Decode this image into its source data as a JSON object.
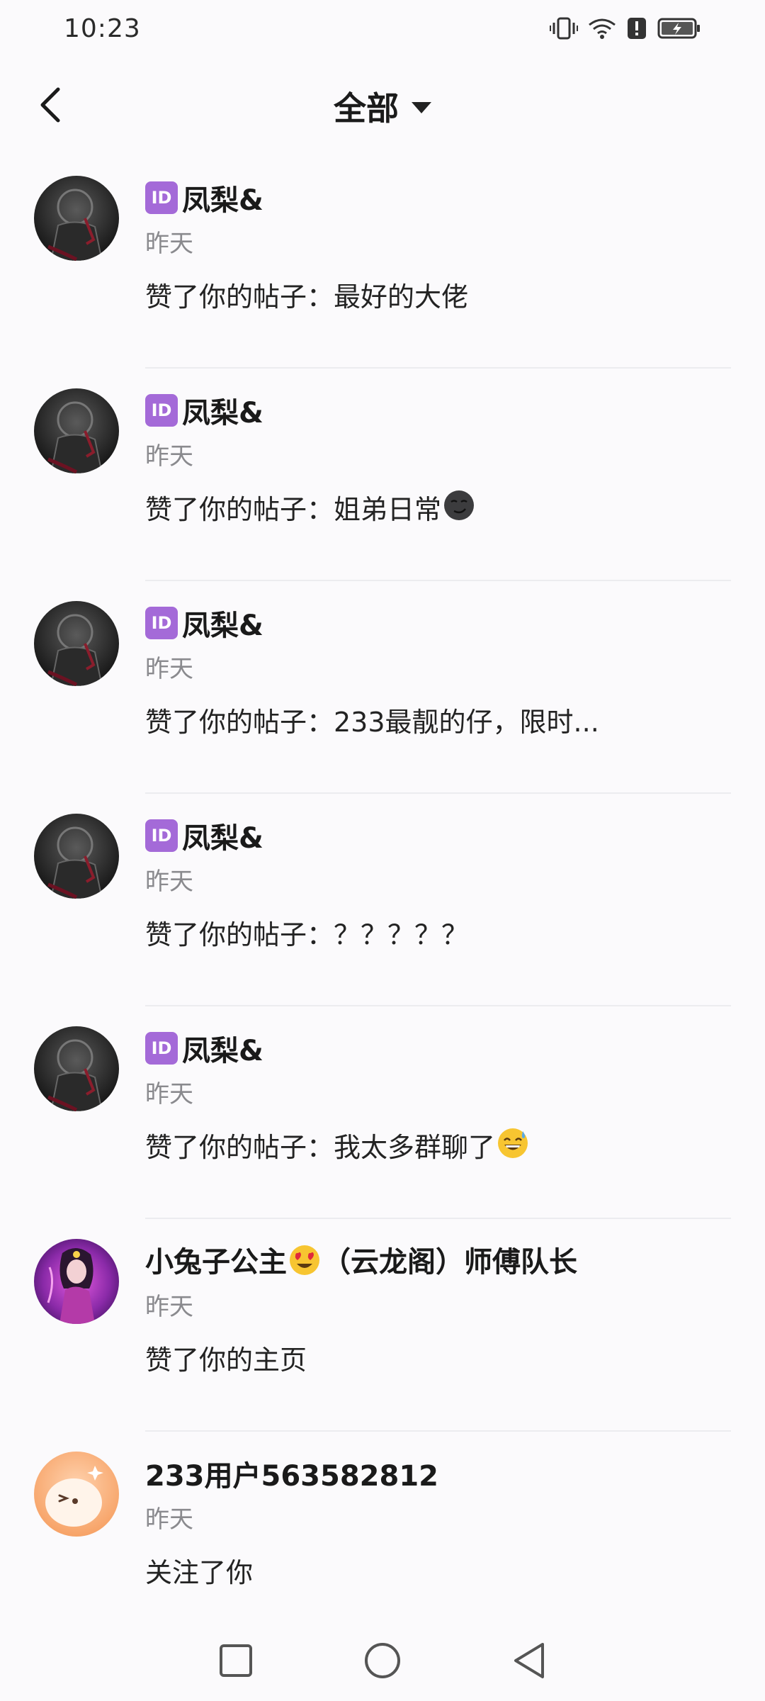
{
  "status_bar": {
    "time": "10:23",
    "icons": [
      "vibrate-icon",
      "wifi-icon",
      "alert-icon",
      "battery-charging-icon"
    ]
  },
  "header": {
    "title": "全部",
    "back_icon": "chevron-left-icon",
    "dropdown_icon": "caret-down-icon"
  },
  "notifications": [
    {
      "has_id_badge": true,
      "badge": "ID",
      "name": "凤梨&",
      "time": "昨天",
      "action": "赞了你的帖子：最好的大佬",
      "emoji": ""
    },
    {
      "has_id_badge": true,
      "badge": "ID",
      "name": "凤梨&",
      "time": "昨天",
      "action": "赞了你的帖子：姐弟日常",
      "emoji": "smirk-moon-emoji"
    },
    {
      "has_id_badge": true,
      "badge": "ID",
      "name": "凤梨&",
      "time": "昨天",
      "action": "赞了你的帖子：233最靓的仔，限时...",
      "emoji": ""
    },
    {
      "has_id_badge": true,
      "badge": "ID",
      "name": "凤梨&",
      "time": "昨天",
      "action": "赞了你的帖子：？？？？？",
      "emoji": ""
    },
    {
      "has_id_badge": true,
      "badge": "ID",
      "name": "凤梨&",
      "time": "昨天",
      "action": "赞了你的帖子：我太多群聊了",
      "emoji": "sweat-smile-emoji"
    },
    {
      "has_id_badge": false,
      "badge": "",
      "name": "小兔子公主",
      "name_suffix": "（云龙阁）师傅队长",
      "name_emoji": "heart-eyes-emoji",
      "time": "昨天",
      "action": "赞了你的主页",
      "emoji": ""
    },
    {
      "has_id_badge": false,
      "badge": "",
      "name": "233用户563582812",
      "time": "昨天",
      "action": "关注了你",
      "emoji": ""
    }
  ],
  "nav_bar": {
    "icons": [
      "recents-square-icon",
      "home-circle-icon",
      "back-triangle-icon"
    ]
  },
  "colors": {
    "background": "#fbfafc",
    "id_badge": "#a46ad8",
    "secondary_text": "#8a8a8e"
  }
}
